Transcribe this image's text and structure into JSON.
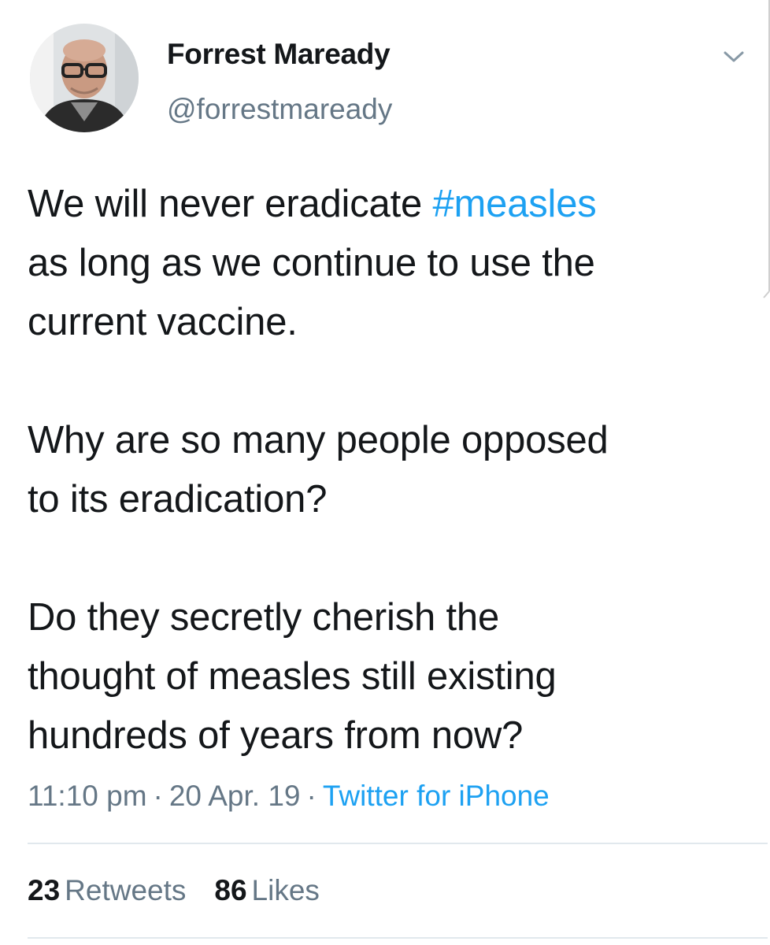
{
  "user": {
    "display_name": "Forrest Maready",
    "handle": "@forrestmaready"
  },
  "icons": {
    "avatar": "user-photo",
    "menu": "chevron-down-icon"
  },
  "tweet": {
    "paragraphs": [
      {
        "before": "We will never eradicate ",
        "hashtag": "#measles",
        "after": " as long as we continue to use the current vaccine."
      },
      {
        "text": "Why are so many people opposed to its eradication?"
      },
      {
        "text": "Do they secretly cherish the thought of measles still existing hundreds of years from now?"
      }
    ],
    "lines": {
      "p1_l1_before": "We will never eradicate ",
      "p1_l1_hashtag": "#measles",
      "p1_l2": "as long as we continue to use the",
      "p1_l3": "current vaccine.",
      "p2_l1": "Why are so many people opposed",
      "p2_l2": "to its eradication?",
      "p3_l1": "Do they secretly cherish the",
      "p3_l2": "thought of measles still existing",
      "p3_l3": "hundreds of years from now?"
    }
  },
  "meta": {
    "time": "11:10 pm",
    "separator": "·",
    "date": "20 Apr. 19",
    "source": "Twitter for iPhone"
  },
  "stats": {
    "retweets_count": "23",
    "retweets_label": "Retweets",
    "likes_count": "86",
    "likes_label": "Likes"
  },
  "colors": {
    "link": "#1da1f2",
    "secondary_text": "#657786",
    "primary_text": "#14171a",
    "divider": "#e1e8ed"
  }
}
